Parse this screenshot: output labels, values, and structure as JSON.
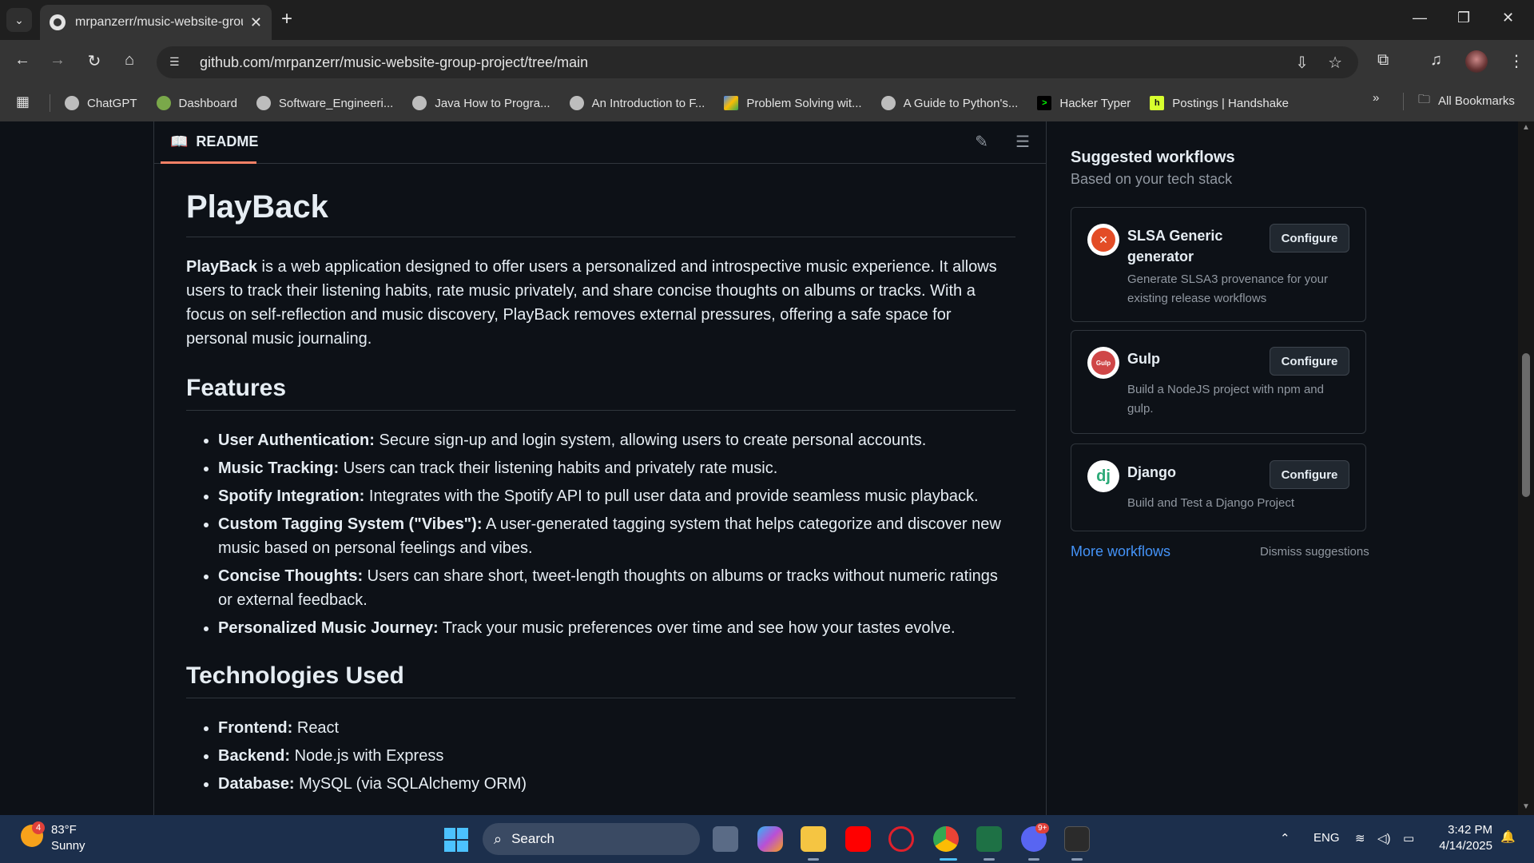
{
  "browser": {
    "tab_title": "mrpanzerr/music-website-group-project",
    "url": "github.com/mrpanzerr/music-website-group-project/tree/main",
    "bookmarks": [
      {
        "label": "ChatGPT",
        "icon": "chatgpt-icon"
      },
      {
        "label": "Dashboard",
        "icon": "dashboard-icon"
      },
      {
        "label": "Software_Engineeri...",
        "icon": "globe-icon"
      },
      {
        "label": "Java How to Progra...",
        "icon": "globe-icon"
      },
      {
        "label": "An Introduction to F...",
        "icon": "globe-icon"
      },
      {
        "label": "Problem Solving wit...",
        "icon": "drive-icon"
      },
      {
        "label": "A Guide to Python's...",
        "icon": "globe-icon"
      },
      {
        "label": "Hacker Typer",
        "icon": "terminal-icon"
      },
      {
        "label": "Postings | Handshake",
        "icon": "handshake-icon"
      }
    ],
    "all_bookmarks": "All Bookmarks"
  },
  "readme": {
    "tab_label": "README",
    "title": "PlayBack",
    "intro_bold": "PlayBack",
    "intro_rest": " is a web application designed to offer users a personalized and introspective music experience. It allows users to track their listening habits, rate music privately, and share concise thoughts on albums or tracks. With a focus on self-reflection and music discovery, PlayBack removes external pressures, offering a safe space for personal music journaling.",
    "features_heading": "Features",
    "features": [
      {
        "bold": "User Authentication:",
        "text": " Secure sign-up and login system, allowing users to create personal accounts."
      },
      {
        "bold": "Music Tracking:",
        "text": " Users can track their listening habits and privately rate music."
      },
      {
        "bold": "Spotify Integration:",
        "text": " Integrates with the Spotify API to pull user data and provide seamless music playback."
      },
      {
        "bold": "Custom Tagging System (\"Vibes\"):",
        "text": " A user-generated tagging system that helps categorize and discover new music based on personal feelings and vibes."
      },
      {
        "bold": "Concise Thoughts:",
        "text": " Users can share short, tweet-length thoughts on albums or tracks without numeric ratings or external feedback."
      },
      {
        "bold": "Personalized Music Journey:",
        "text": " Track your music preferences over time and see how your tastes evolve."
      }
    ],
    "tech_heading": "Technologies Used",
    "tech": [
      {
        "bold": "Frontend:",
        "text": " React"
      },
      {
        "bold": "Backend:",
        "text": " Node.js with Express"
      },
      {
        "bold": "Database:",
        "text": " MySQL (via SQLAlchemy ORM)"
      }
    ]
  },
  "sidebar": {
    "title": "Suggested workflows",
    "subtitle": "Based on your tech stack",
    "workflows": [
      {
        "name": "SLSA Generic generator",
        "desc": "Generate SLSA3 provenance for your existing release workflows",
        "button": "Configure",
        "logo_text": "✕",
        "logo_color": "#e34c26"
      },
      {
        "name": "Gulp",
        "desc": "Build a NodeJS project with npm and gulp.",
        "button": "Configure",
        "logo_text": "Gulp",
        "logo_color": "#cf4647"
      },
      {
        "name": "Django",
        "desc": "Build and Test a Django Project",
        "button": "Configure",
        "logo_text": "dj",
        "logo_color": "#2ba977"
      }
    ],
    "more_workflows": "More workflows",
    "dismiss": "Dismiss suggestions"
  },
  "taskbar": {
    "weather_badge": "4",
    "temperature": "83°F",
    "condition": "Sunny",
    "search_label": "Search",
    "language": "ENG",
    "time": "3:42 PM",
    "date": "4/14/2025",
    "discord_badge": "9+"
  }
}
